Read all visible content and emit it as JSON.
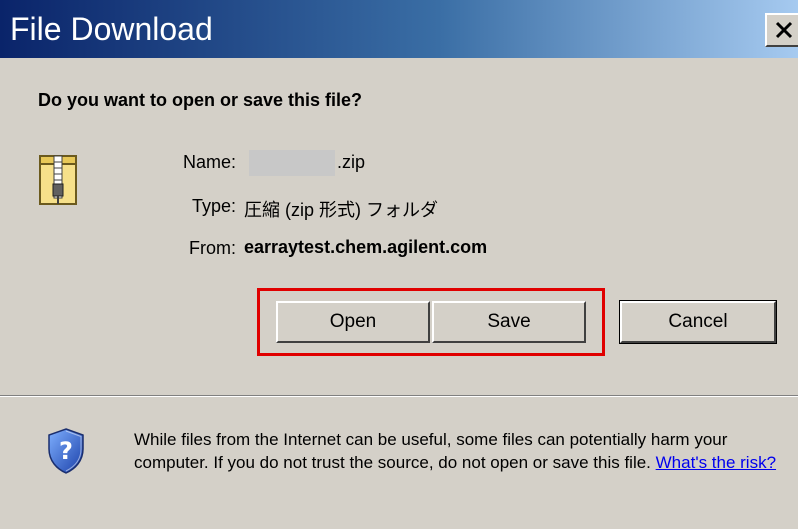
{
  "window": {
    "title": "File Download",
    "close_symbol": "x"
  },
  "prompt": {
    "question": "Do you want to open or save this file?"
  },
  "file": {
    "icon": "zip-folder-icon",
    "name_label": "Name:",
    "name_extension": ".zip",
    "type_label": "Type:",
    "type_value": "圧縮 (zip 形式) フォルダ",
    "from_label": "From:",
    "from_value": "earraytest.chem.agilent.com"
  },
  "buttons": {
    "open": "Open",
    "save": "Save",
    "cancel": "Cancel"
  },
  "warning": {
    "icon": "shield-question-icon",
    "text": "While files from the Internet can be useful, some files can potentially harm your computer. If you do not trust the source, do not open or save this file.",
    "link_text": "What's the risk?"
  },
  "colors": {
    "titlebar_start": "#0a246a",
    "titlebar_end": "#a6caf0",
    "dialog_background": "#d4d0c8",
    "highlight_border": "#e00000",
    "link": "#0000ee"
  }
}
